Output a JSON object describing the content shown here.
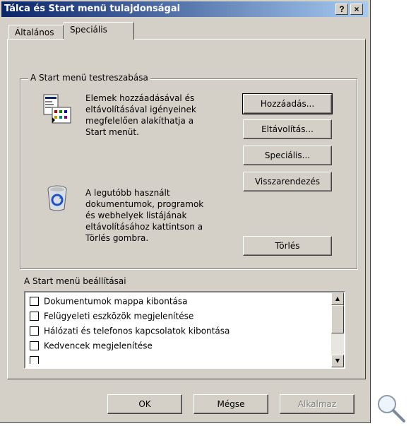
{
  "window": {
    "title": "Tálca és Start menü tulajdonságai",
    "help_label": "?",
    "close_label": "×"
  },
  "tabs": [
    {
      "label": "Általános"
    },
    {
      "label": "Speciális"
    }
  ],
  "group": {
    "label": "A Start menü testreszabása",
    "customize_text": [
      "Elemek hozzáadásával és",
      "eltávolításával igényeinek",
      "megfelelően alakíthatja a",
      "Start menüt."
    ],
    "recent_text": [
      "A legutóbb használt",
      "dokumentumok, programok",
      "és webhelyek listájának",
      "eltávolításához kattintson a",
      "Törlés gombra."
    ],
    "buttons": {
      "add": "Hozzáadás...",
      "remove": "Eltávolítás...",
      "advanced": "Speciális...",
      "resort": "Visszarendezés",
      "clear": "Törlés"
    }
  },
  "settings": {
    "label": "A Start menü beállításai",
    "items": [
      {
        "label": "Dokumentumok mappa kibontása",
        "checked": false
      },
      {
        "label": "Felügyeleti eszközök megjelenítése",
        "checked": false
      },
      {
        "label": "Hálózati és telefonos kapcsolatok kibontása",
        "checked": false
      },
      {
        "label": "Kedvencek megjelenítése",
        "checked": false
      }
    ]
  },
  "footer": {
    "ok": "OK",
    "cancel": "Mégse",
    "apply": "Alkalmaz"
  },
  "icons": [
    "start-menu-icon",
    "recycle-bin-icon",
    "magnifier-icon",
    "scroll-up-icon",
    "scroll-down-icon"
  ]
}
